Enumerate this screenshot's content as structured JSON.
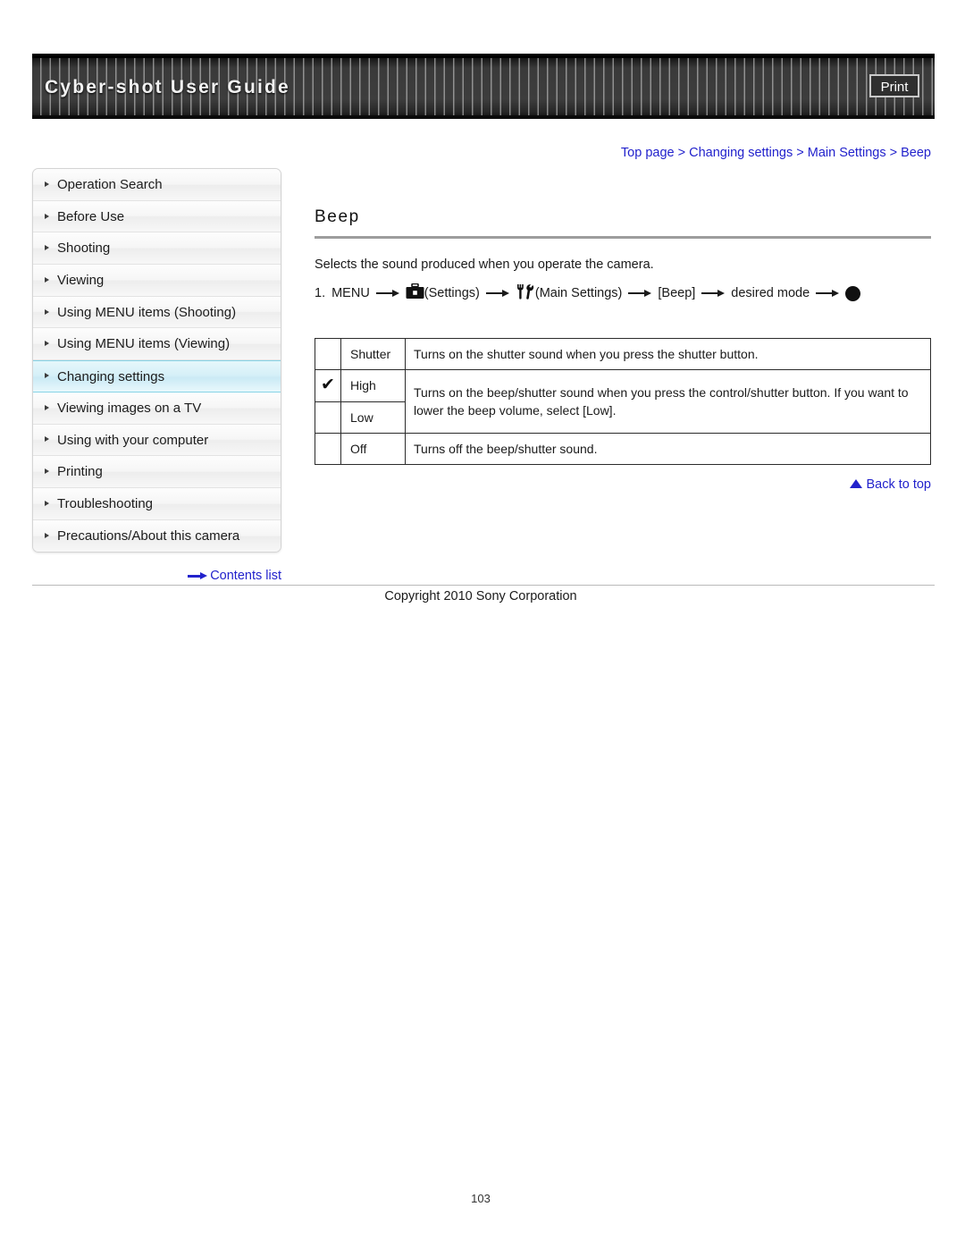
{
  "header": {
    "app_title": "Cyber-shot User Guide",
    "print_label": "Print"
  },
  "breadcrumb": {
    "separator": " > ",
    "items": [
      {
        "label": "Top page"
      },
      {
        "label": "Changing settings"
      },
      {
        "label": "Main Settings"
      },
      {
        "label": "Beep"
      }
    ]
  },
  "sidebar": {
    "items": [
      {
        "label": "Operation Search",
        "active": false
      },
      {
        "label": "Before Use",
        "active": false
      },
      {
        "label": "Shooting",
        "active": false
      },
      {
        "label": "Viewing",
        "active": false
      },
      {
        "label": "Using MENU items (Shooting)",
        "active": false
      },
      {
        "label": "Using MENU items (Viewing)",
        "active": false
      },
      {
        "label": "Changing settings",
        "active": true
      },
      {
        "label": "Viewing images on a TV",
        "active": false
      },
      {
        "label": "Using with your computer",
        "active": false
      },
      {
        "label": "Printing",
        "active": false
      },
      {
        "label": "Troubleshooting",
        "active": false
      },
      {
        "label": "Precautions/About this camera",
        "active": false
      }
    ],
    "contents_list_label": "Contents list"
  },
  "main": {
    "heading": "Beep",
    "intro": "Selects the sound produced when you operate the camera.",
    "step": {
      "number": "1.",
      "menu_label": "MENU",
      "settings_label": "(Settings)",
      "main_settings_label": "(Main Settings)",
      "beep_label": "[Beep]",
      "desired_mode_label": "desired mode"
    },
    "table": {
      "rows": [
        {
          "checked": "",
          "label": "Shutter",
          "description": "Turns on the shutter sound when you press the shutter button."
        },
        {
          "checked": "✔",
          "label": "High",
          "description": "Turns on the beep/shutter sound when you press the control/shutter button. If you want to lower the beep volume, select [Low]."
        },
        {
          "checked": "",
          "label": "Low",
          "description": ""
        },
        {
          "checked": "",
          "label": "Off",
          "description": "Turns off the beep/shutter sound."
        }
      ]
    },
    "back_to_top_label": "Back to top"
  },
  "footer": {
    "copyright": "Copyright 2010 Sony Corporation",
    "page_number": "103"
  },
  "colors": {
    "link_blue": "#2222cc",
    "header_dark": "#3a3a3a",
    "active_nav": "#cbeaf5",
    "rule_gray": "#9d9d9d"
  }
}
